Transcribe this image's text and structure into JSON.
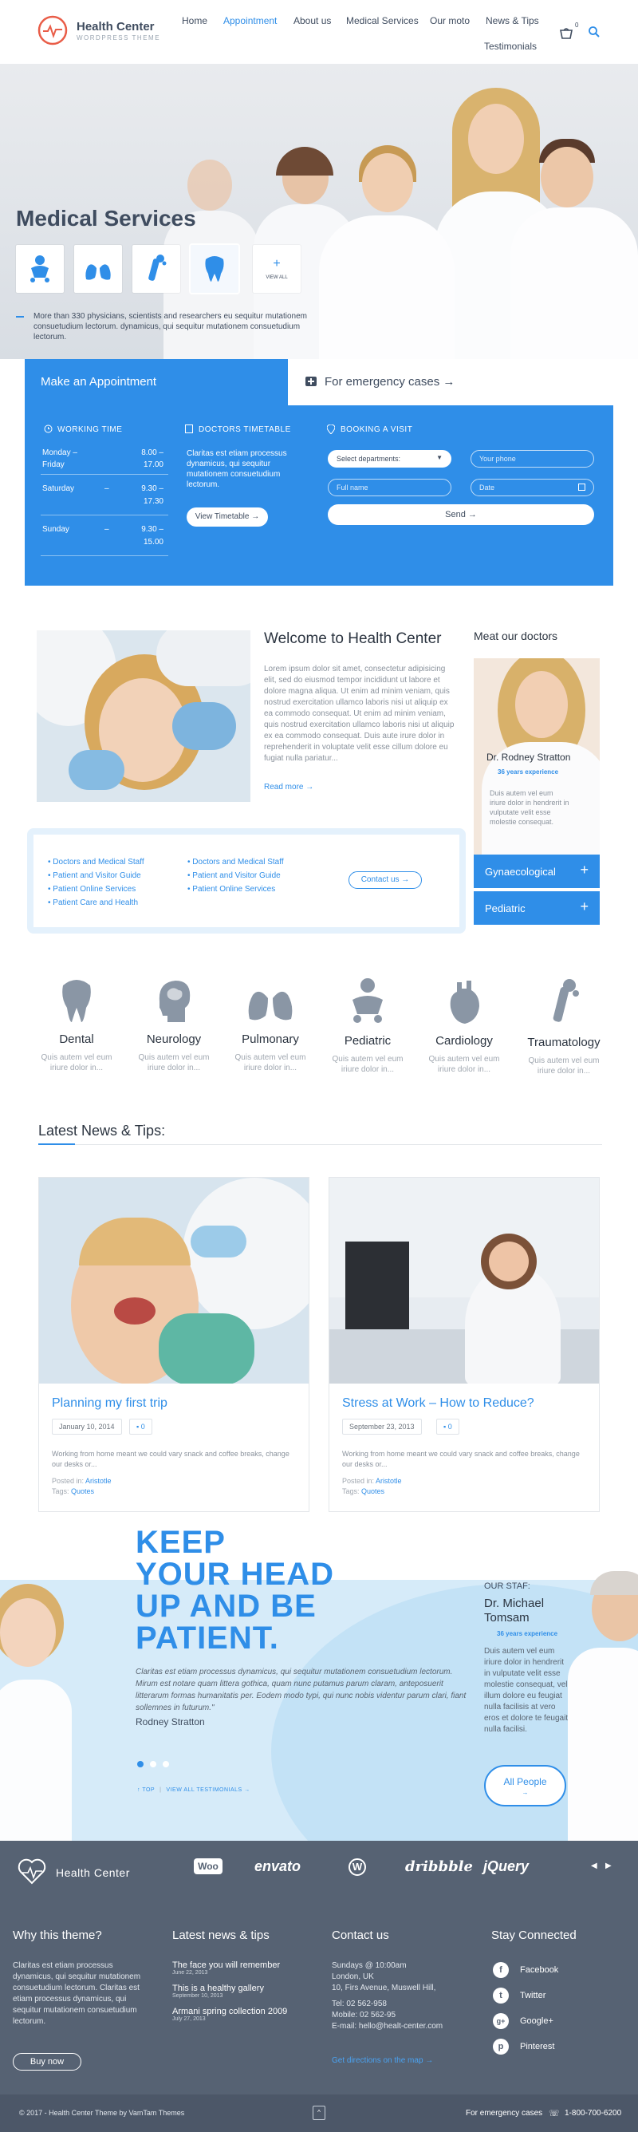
{
  "header": {
    "logo_title": "Health Center",
    "logo_sub": "WORDPRESS THEME",
    "nav": [
      "Home",
      "Appointment",
      "About us",
      "Medical Services",
      "Our moto",
      "News & Tips",
      "Testimonials"
    ],
    "cart_count": "0"
  },
  "hero": {
    "title": "Medical Services",
    "view_all": "VIEW ALL",
    "text": "More than 330 physicians, scientists and researchers eu sequitur mutationem consuetudium lectorum. dynamicus, qui sequitur mutationem consuetudium lectorum."
  },
  "appointment": {
    "tab_label": "Make an Appointment",
    "emergency_label": "For emergency cases →",
    "working_time": {
      "heading": "WORKING TIME",
      "rows": [
        {
          "day": "Monday –",
          "dash": "",
          "from": "8.00 –"
        },
        {
          "day": "Friday",
          "dash": "",
          "from": "17.00"
        },
        {
          "day": "Saturday",
          "dash": "–",
          "from": "9.30 –"
        },
        {
          "day": "",
          "dash": "",
          "from": "17.30"
        },
        {
          "day": "Sunday",
          "dash": "–",
          "from": "9.30 –"
        },
        {
          "day": "",
          "dash": "",
          "from": "15.00"
        }
      ]
    },
    "timetable": {
      "heading": "DOCTORS TIMETABLE",
      "text": "Claritas est etiam processus dynamicus, qui sequitur mutationem consuetudium lectorum.",
      "button": "View Timetable →"
    },
    "booking": {
      "heading": "BOOKING A VISIT",
      "department": "Select departments:",
      "phone_ph": "Your phone",
      "name_ph": "Full name",
      "date_ph": "Date",
      "send": "Send →"
    }
  },
  "welcome": {
    "title": "Welcome to Health Center",
    "text": "Lorem ipsum dolor sit amet, consectetur adipisicing elit, sed do eiusmod tempor incididunt ut labore et dolore magna aliqua. Ut enim ad minim veniam, quis nostrud exercitation ullamco laboris nisi ut aliquip ex ea commodo consequat. Ut enim ad minim veniam, quis nostrud exercitation ullamco laboris nisi ut aliquip ex ea commodo consequat. Duis aute irure dolor in reprehenderit in voluptate velit esse cillum dolore eu fugiat nulla pariatur...",
    "read_more": "Read more →",
    "links_left": [
      "Doctors and Medical Staff",
      "Patient and Visitor Guide",
      "Patient Online Services",
      "Patient Care and Health"
    ],
    "links_right": [
      "Doctors and Medical Staff",
      "Patient and Visitor Guide",
      "Patient Online Services"
    ],
    "contact_button": "Contact us →"
  },
  "doctors": {
    "heading": "Meat our doctors",
    "name": "Dr. Rodney Stratton",
    "experience": "36 years experience",
    "text": "Duis autem vel eum iriure dolor in hendrerit in vulputate velit esse molestie consequat.",
    "accordion": [
      "Gynaecological",
      "Pediatric"
    ]
  },
  "departments": [
    {
      "name": "Dental",
      "text": "Quis autem vel eum iriure dolor in..."
    },
    {
      "name": "Neurology",
      "text": "Quis autem vel eum iriure dolor in..."
    },
    {
      "name": "Pulmonary",
      "text": "Quis autem vel eum iriure dolor in..."
    },
    {
      "name": "Pediatric",
      "text": "Quis autem vel eum iriure dolor in..."
    },
    {
      "name": "Cardiology",
      "text": "Quis autem vel eum iriure dolor in..."
    },
    {
      "name": "Traumatology",
      "text": "Quis autem vel eum iriure dolor in..."
    }
  ],
  "news": {
    "heading": "Latest News & Tips:",
    "items": [
      {
        "title": "Planning my first trip",
        "date": "January 10, 2014",
        "comments": "0",
        "text": "Working from home meant we could vary snack and coffee breaks, change our desks or...",
        "posted_label": "Posted in:",
        "author": "Aristotle",
        "tags_label": "Tags:",
        "tag": "Quotes"
      },
      {
        "title": "Stress at Work – How to Reduce?",
        "date": "September 23, 2013",
        "comments": "0",
        "text": "Working from home meant we could vary snack and coffee breaks, change our desks or...",
        "posted_label": "Posted in:",
        "author": "Aristotle",
        "tags_label": "Tags:",
        "tag": "Quotes"
      }
    ]
  },
  "promo": {
    "headline": [
      "KEEP",
      "YOUR HEAD",
      "UP AND BE",
      "PATIENT."
    ],
    "quote": "Claritas est etiam processus dynamicus, qui sequitur mutationem consuetudium lectorum. Mirum est notare quam littera gothica, quam nunc putamus parum claram, anteposuerit litterarum formas humanitatis per. Eodem modo typi, qui nunc nobis videntur parum clari, fiant sollemnes in futurum.\"",
    "author": "Rodney Stratton",
    "top_link": "TOP",
    "testimonials_link": "VIEW ALL TESTIMONIALS →",
    "staff_label": "OUR STAF:",
    "staff_name_1": "Dr. Michael",
    "staff_name_2": "Tomsam",
    "staff_exp": "36 years experience",
    "staff_text": "Duis autem vel eum iriure dolor in hendrerit in vulputate velit esse molestie consequat, vel illum dolore eu feugiat nulla facilisis at vero eros et dolore te feugait nulla facilisi.",
    "all_people": "All People",
    "all_people_arrow": "→"
  },
  "footer": {
    "logo_title": "Health Center",
    "partners": [
      "Woo",
      "envato",
      "WordPress",
      "dribbble",
      "jQuery"
    ],
    "why_heading": "Why this theme?",
    "why_text": "Claritas est etiam processus dynamicus, qui sequitur mutationem consuetudium lectorum. Claritas est etiam processus dynamicus, qui sequitur mutationem consuetudium lectorum.",
    "buy_now": "Buy now",
    "news_heading": "Latest news & tips",
    "news": [
      {
        "title": "The face you will remember",
        "date": "June 22, 2013"
      },
      {
        "title": "This is a healthy gallery",
        "date": "September 10, 2013"
      },
      {
        "title": "Armani spring collection 2009",
        "date": "July 27, 2013"
      }
    ],
    "contact_heading": "Contact us",
    "contact_lines": [
      "Sundays @ 10:00am",
      "London, UK",
      "10, Firs Avenue, Muswell Hill,",
      "Tel: 02 562-958",
      "Mobile: 02 562-95",
      "E-mail: hello@healt-center.com"
    ],
    "directions": "Get directions on the map →",
    "stay_heading": "Stay Connected",
    "social": [
      "Facebook",
      "Twitter",
      "Google+",
      "Pinterest"
    ],
    "copyright": "© 2017 - Health Center Theme by VamTam Themes",
    "emergency": "For emergency cases",
    "phone": "1-800-700-6200"
  },
  "colors": {
    "accent": "#2f8ee8",
    "dark": "#3f4c5f",
    "footer": "#566273"
  }
}
